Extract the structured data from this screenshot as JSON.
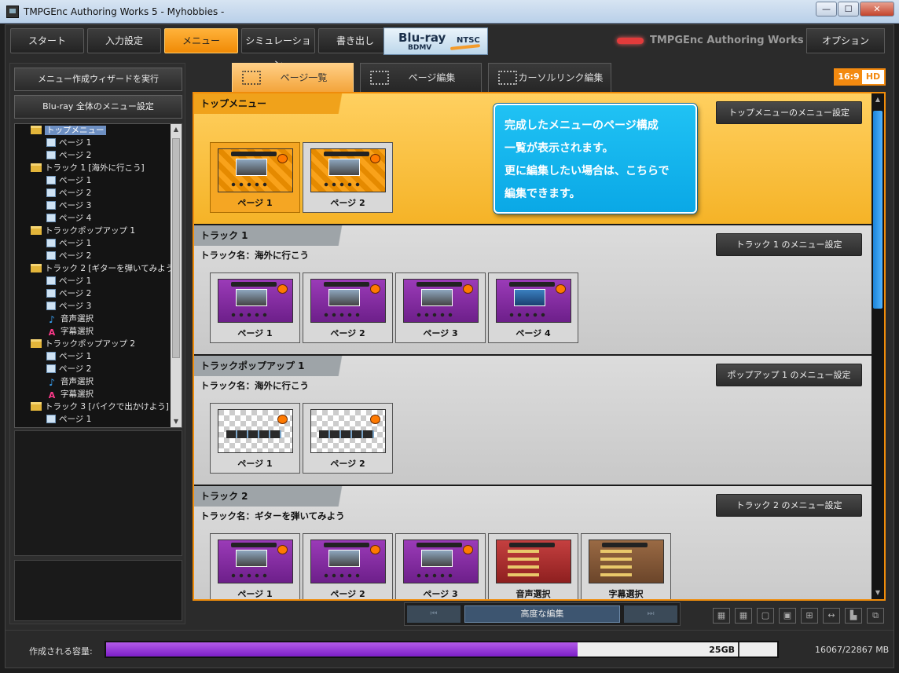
{
  "window": {
    "title": "TMPGEnc Authoring Works 5 - Myhobbies -",
    "min": "—",
    "max": "☐",
    "close": "✕"
  },
  "nav": [
    {
      "label": "スタート",
      "active": false
    },
    {
      "label": "入力設定",
      "active": false
    },
    {
      "label": "メニュー",
      "active": true
    },
    {
      "label": "シミュレーション",
      "active": false
    },
    {
      "label": "書き出し",
      "active": false
    }
  ],
  "disc_badge": {
    "line1": "Blu-ray",
    "line2": "BDMV",
    "line3": "NTSC"
  },
  "brand": "TMPGEnc Authoring Works 5",
  "options_label": "オプション",
  "left": {
    "wizard_button": "メニュー作成ウィザードを実行",
    "global_settings_button": "Blu-ray 全体のメニュー設定",
    "tree": [
      {
        "label": "トップメニュー",
        "type": "folder",
        "level": 0,
        "selected": true
      },
      {
        "label": "ページ 1",
        "type": "page",
        "level": 1
      },
      {
        "label": "ページ 2",
        "type": "page",
        "level": 1
      },
      {
        "label": "トラック 1 [海外に行こう]",
        "type": "folder",
        "level": 0
      },
      {
        "label": "ページ 1",
        "type": "page",
        "level": 1
      },
      {
        "label": "ページ 2",
        "type": "page",
        "level": 1
      },
      {
        "label": "ページ 3",
        "type": "page",
        "level": 1
      },
      {
        "label": "ページ 4",
        "type": "page",
        "level": 1
      },
      {
        "label": "トラックポップアップ 1",
        "type": "folder",
        "level": 0
      },
      {
        "label": "ページ 1",
        "type": "page",
        "level": 1
      },
      {
        "label": "ページ 2",
        "type": "page",
        "level": 1
      },
      {
        "label": "トラック 2 [ギターを弾いてみよう]",
        "type": "folder",
        "level": 0
      },
      {
        "label": "ページ 1",
        "type": "page",
        "level": 1
      },
      {
        "label": "ページ 2",
        "type": "page",
        "level": 1
      },
      {
        "label": "ページ 3",
        "type": "page",
        "level": 1
      },
      {
        "label": "音声選択",
        "type": "music",
        "level": 1
      },
      {
        "label": "字幕選択",
        "type": "sub",
        "level": 1
      },
      {
        "label": "トラックポップアップ 2",
        "type": "folder",
        "level": 0
      },
      {
        "label": "ページ 1",
        "type": "page",
        "level": 1
      },
      {
        "label": "ページ 2",
        "type": "page",
        "level": 1
      },
      {
        "label": "音声選択",
        "type": "music",
        "level": 1
      },
      {
        "label": "字幕選択",
        "type": "sub",
        "level": 1
      },
      {
        "label": "トラック 3 [バイクで出かけよう]",
        "type": "folder",
        "level": 0
      },
      {
        "label": "ページ 1",
        "type": "page",
        "level": 1
      },
      {
        "label": "ページ 1",
        "type": "page",
        "level": 1
      }
    ]
  },
  "tabs": [
    {
      "label": "ページ一覧",
      "active": true
    },
    {
      "label": "ページ編集",
      "active": false
    },
    {
      "label": "カーソルリンク編集",
      "active": false
    }
  ],
  "aspect_badge": {
    "ratio": "16:9",
    "quality": "HD"
  },
  "sections": [
    {
      "style": "top",
      "title": "トップメニュー",
      "subtitle": "",
      "button": "トップメニューのメニュー設定",
      "pages": [
        {
          "label": "ページ 1",
          "theme": "orange",
          "selected": true
        },
        {
          "label": "ページ 2",
          "theme": "orange",
          "selected": false
        }
      ]
    },
    {
      "style": "grey",
      "title": "トラック 1",
      "subtitle": "トラック名：海外に行こう",
      "button": "トラック 1 のメニュー設定",
      "pages": [
        {
          "label": "ページ 1",
          "theme": "purple"
        },
        {
          "label": "ページ 2",
          "theme": "purple"
        },
        {
          "label": "ページ 3",
          "theme": "purple"
        },
        {
          "label": "ページ 4",
          "theme": "purple"
        }
      ]
    },
    {
      "style": "grey",
      "title": "トラックポップアップ 1",
      "subtitle": "トラック名：海外に行こう",
      "button": "ポップアップ 1 のメニュー設定",
      "pages": [
        {
          "label": "ページ 1",
          "theme": "check"
        },
        {
          "label": "ページ 2",
          "theme": "check"
        }
      ]
    },
    {
      "style": "grey",
      "title": "トラック 2",
      "subtitle": "トラック名：ギターを弾いてみよう",
      "button": "トラック 2 のメニュー設定",
      "pages": [
        {
          "label": "ページ 1",
          "theme": "purple"
        },
        {
          "label": "ページ 2",
          "theme": "purple"
        },
        {
          "label": "ページ 3",
          "theme": "purple"
        },
        {
          "label": "音声選択",
          "theme": "red"
        },
        {
          "label": "字幕選択",
          "theme": "brown"
        }
      ]
    }
  ],
  "tooltip": {
    "line1": "完成したメニューのページ構成",
    "line2": "一覧が表示されます。",
    "line3": "更に編集したい場合は、こちらで",
    "line4": "編集できます。"
  },
  "bottom": {
    "prev": "⏮",
    "advanced_edit": "高度な編集",
    "next": "⏭"
  },
  "view_icons": [
    "grid-4-icon",
    "grid-9-icon",
    "safe-area-icon",
    "frame-icon",
    "split-icon",
    "width-icon",
    "align-icon",
    "layers-icon"
  ],
  "status": {
    "capacity_label": "作成される容量:",
    "used_fraction": 0.7026,
    "disc_label": "25GB",
    "totals": "16067/22867 MB"
  }
}
